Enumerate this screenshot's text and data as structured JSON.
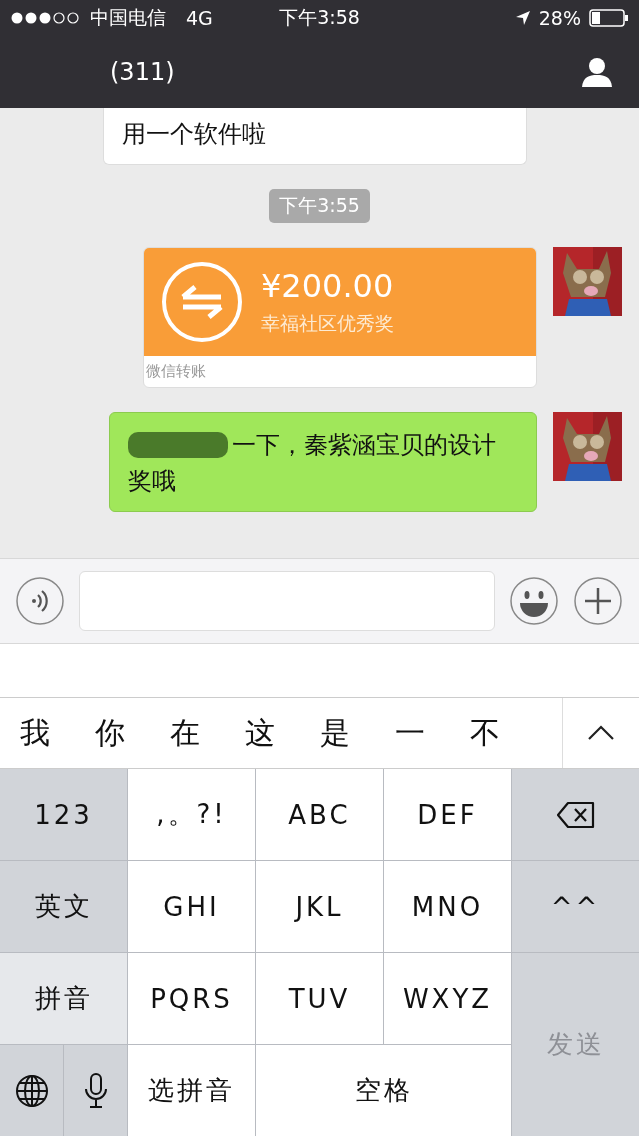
{
  "status_bar": {
    "carrier": "中国电信",
    "network": "4G",
    "time": "下午3:58",
    "battery": "28%"
  },
  "nav": {
    "title": "(311)"
  },
  "messages": [
    {
      "kind": "text",
      "outgoing": false,
      "lines": [
        "用一个软件啦"
      ]
    },
    {
      "kind": "timestamp",
      "text": "下午3:55"
    },
    {
      "kind": "transfer",
      "outgoing": true,
      "amount": "¥200.00",
      "note": "幸福社区优秀奖",
      "footer": "微信转账"
    },
    {
      "kind": "text",
      "outgoing": true,
      "lines": [
        "一下，秦紫涵宝贝的设计",
        "奖哦"
      ]
    }
  ],
  "candidates": [
    "我",
    "你",
    "在",
    "这",
    "是",
    "一",
    "不"
  ],
  "keys": [
    {
      "kind": "function",
      "label": "123"
    },
    {
      "kind": "letter",
      "label": ",。?!"
    },
    {
      "kind": "letter",
      "label": "ABC"
    },
    {
      "kind": "letter",
      "label": "DEF"
    },
    {
      "kind": "delete"
    },
    {
      "kind": "function",
      "label": "英文"
    },
    {
      "kind": "letter",
      "label": "GHI"
    },
    {
      "kind": "letter",
      "label": "JKL"
    },
    {
      "kind": "letter",
      "label": "MNO"
    },
    {
      "kind": "function",
      "label": "^^"
    },
    {
      "kind": "mode",
      "label": "拼音"
    },
    {
      "kind": "letter",
      "label": "PQRS"
    },
    {
      "kind": "letter",
      "label": "TUV"
    },
    {
      "kind": "letter",
      "label": "WXYZ"
    },
    {
      "kind": "send",
      "label": "发送",
      "disabled": true
    },
    {
      "kind": "globe"
    },
    {
      "kind": "mic"
    },
    {
      "kind": "letter",
      "label": "选拼音"
    },
    {
      "kind": "space",
      "label": "空格"
    }
  ]
}
